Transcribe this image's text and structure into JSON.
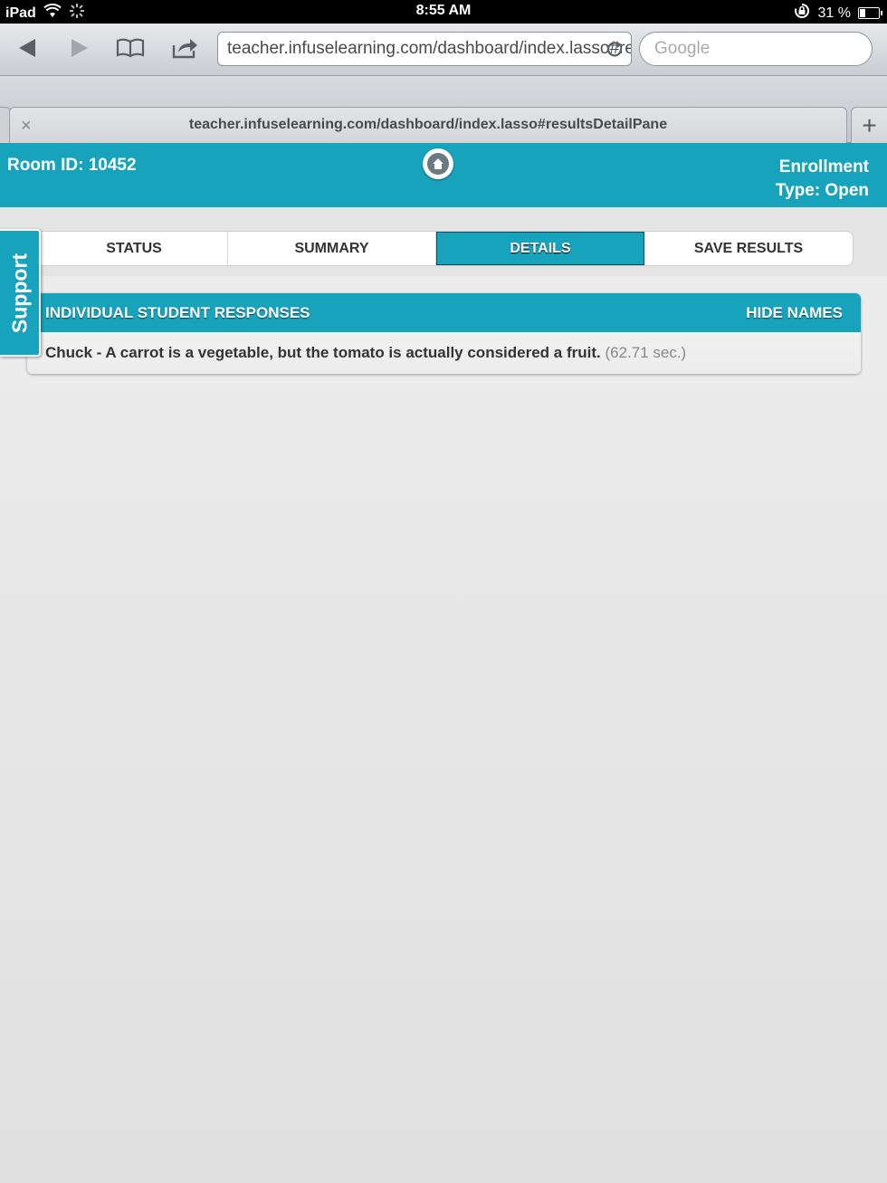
{
  "status_bar": {
    "device": "iPad",
    "time": "8:55 AM",
    "battery": "31 %",
    "battery_level": 0.31
  },
  "browser": {
    "url": "teacher.infuselearning.com/dashboard/index.lasso#resultsDetailPane",
    "search_placeholder": "Google",
    "tab_title": "teacher.infuselearning.com/dashboard/index.lasso#resultsDetailPane",
    "tab_close": "×",
    "new_tab": "+"
  },
  "header": {
    "room_id": "Room ID: 10452",
    "enrollment_line1": "Enrollment",
    "enrollment_line2": "Type: Open"
  },
  "tabs": [
    {
      "label": "STATUS",
      "active": false
    },
    {
      "label": "SUMMARY",
      "active": false
    },
    {
      "label": "DETAILS",
      "active": true
    },
    {
      "label": "SAVE RESULTS",
      "active": false
    }
  ],
  "support_label": "Support",
  "responses_panel": {
    "title": "INDIVIDUAL STUDENT RESPONSES",
    "hide_names": "HIDE NAMES",
    "items": [
      {
        "text": "Chuck - A carrot is a vegetable, but the tomato is actually considered a fruit.",
        "time": "(62.71 sec.)"
      }
    ]
  },
  "colors": {
    "accent": "#18a3bd",
    "active_tab_border": "#0b4d5a"
  }
}
